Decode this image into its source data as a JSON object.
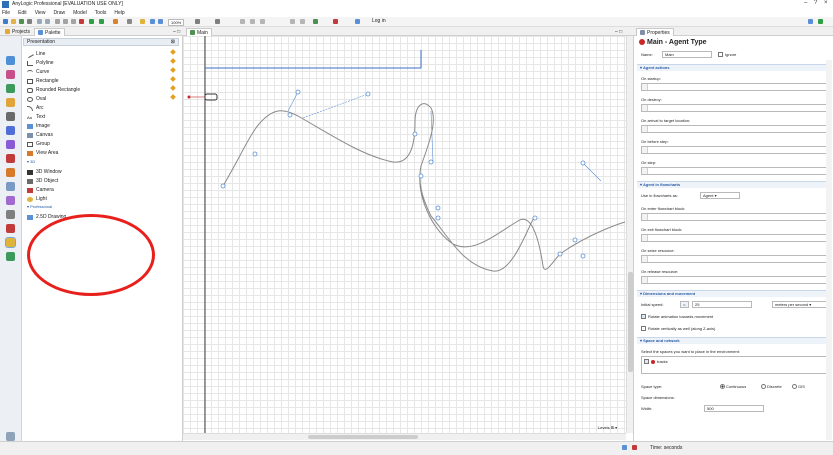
{
  "window": {
    "title": "AnyLogic Professional [EVALUATION USE ONLY]",
    "controls": [
      "–",
      "?",
      "×"
    ]
  },
  "menu": [
    "File",
    "Edit",
    "View",
    "Draw",
    "Model",
    "Tools",
    "Help"
  ],
  "toolbar": {
    "zoom": "100%",
    "login": "Log in"
  },
  "tabs": {
    "projects": "Projects",
    "palette": "Palette",
    "main": "Main",
    "properties": "Properties"
  },
  "palette": {
    "header": "Presentation",
    "items": [
      {
        "label": "Line",
        "icon": "line-icon"
      },
      {
        "label": "Polyline",
        "icon": "polyline-icon"
      },
      {
        "label": "Curve",
        "icon": "curve-icon"
      },
      {
        "label": "Rectangle",
        "icon": "rectangle-icon"
      },
      {
        "label": "Rounded Rectangle",
        "icon": "rounded-rectangle-icon"
      },
      {
        "label": "Oval",
        "icon": "oval-icon"
      },
      {
        "label": "Arc",
        "icon": "arc-icon"
      },
      {
        "label": "Text",
        "icon": "text-icon"
      },
      {
        "label": "Image",
        "icon": "image-icon"
      },
      {
        "label": "Canvas",
        "icon": "canvas-icon"
      },
      {
        "label": "Group",
        "icon": "group-icon"
      },
      {
        "label": "View Area",
        "icon": "view-area-icon"
      }
    ],
    "section_3d": "3D",
    "items_3d": [
      {
        "label": "3D Window",
        "icon": "3d-window-icon"
      },
      {
        "label": "3D Object",
        "icon": "3d-object-icon"
      },
      {
        "label": "Camera",
        "icon": "camera-icon"
      },
      {
        "label": "Light",
        "icon": "light-icon"
      }
    ],
    "section_professional": "Professional",
    "items_professional": [
      {
        "label": "2.5D Drawing",
        "icon": "drawing-25d-icon"
      }
    ]
  },
  "canvas": {
    "levels_label": "Levels"
  },
  "properties": {
    "title": "Main - Agent Type",
    "name_label": "Name:",
    "name_value": "Main",
    "ignore_label": "Ignore",
    "sections": {
      "agent_actions": "Agent actions",
      "agent_flowcharts": "Agent in flowcharts",
      "dimensions": "Dimensions and movement",
      "space": "Space and network"
    },
    "fields": {
      "on_startup": "On startup:",
      "on_destroy": "On destroy:",
      "on_arrival": "On arrival to target location:",
      "on_before_step": "On before step:",
      "on_step": "On step:",
      "use_in_flowcharts": "Use in flowcharts as:",
      "use_in_flowcharts_value": "Agent",
      "on_enter_flowchart": "On enter flowchart block:",
      "on_exit_flowchart": "On exit flowchart block:",
      "on_seize_resource": "On seize resource:",
      "on_release_resource": "On release resource:",
      "initial_speed": "Initial speed:",
      "initial_speed_value": "25",
      "speed_unit": "meters per second",
      "rotate_animation": "Rotate animation towards movement",
      "rotate_vertically": "Rotate vertically as well (along Z-axis)",
      "select_spaces": "Select the spaces you want to place in the environment:",
      "tracks_item": "tracks",
      "space_type": "Space type:",
      "continuous": "Continuous",
      "discrete": "Discrete",
      "gis": "GIS",
      "space_dimensions": "Space dimensions:",
      "width_label": "Width:",
      "width_value": "500"
    }
  },
  "status": {
    "time_units": "Time: seconds"
  },
  "colors": {
    "annotation_circle": "#e8201c",
    "section_text": "#2a5aa8",
    "curve_stroke": "#8a8a8a",
    "handle_stroke": "#5b8fd6"
  }
}
